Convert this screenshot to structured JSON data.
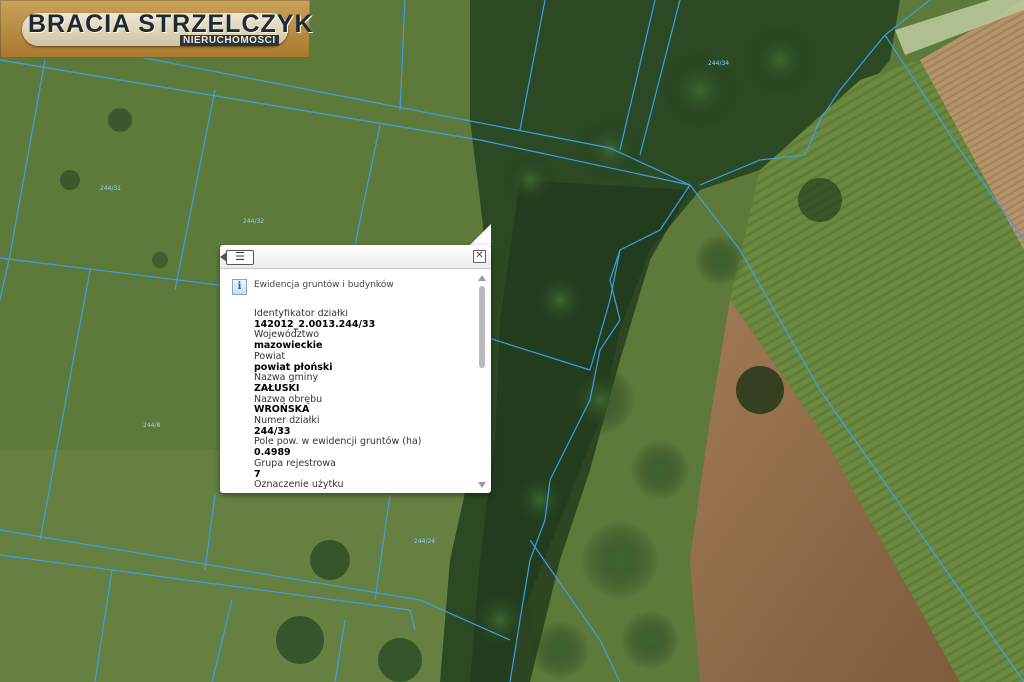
{
  "logo": {
    "name": "BRACIA STRZELCZYK",
    "sub": "NIERUCHOMOŚCI"
  },
  "map": {
    "parcel_labels": [
      "244/34",
      "244/31",
      "244/32",
      "244/8",
      "244/24"
    ]
  },
  "popup": {
    "list_icon": "list-icon",
    "close_icon": "close-icon",
    "section_icon": "info-icon",
    "section_title": "Ewidencja gruntów i budynków",
    "rows": [
      {
        "label": "Identyfikator działki",
        "value": "142012_2.0013.244/33"
      },
      {
        "label": "Województwo",
        "value": "mazowieckie"
      },
      {
        "label": "Powiat",
        "value": "powiat płoński"
      },
      {
        "label": "Nazwa gminy",
        "value": "ZAŁUSKI"
      },
      {
        "label": "Nazwa obrębu",
        "value": "WROŃSKA"
      },
      {
        "label": "Numer działki",
        "value": "244/33"
      },
      {
        "label": "Pole pow. w ewidencji gruntów (ha)",
        "value": "0.4989"
      },
      {
        "label": "Grupa rejestrowa",
        "value": "7"
      },
      {
        "label": "Oznaczenie użytku",
        "value": ""
      }
    ]
  },
  "colors": {
    "parcel_line": "#3aa0e8",
    "forest": "#25401f",
    "meadow": "#5f7a3c",
    "field": "#8a6a45"
  }
}
